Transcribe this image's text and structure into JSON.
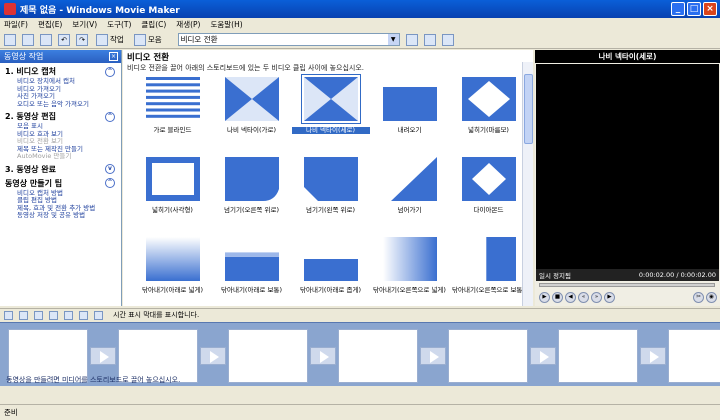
{
  "window": {
    "title": "제목 없음 - Windows Movie Maker"
  },
  "menu": [
    "파일(F)",
    "편집(E)",
    "보기(V)",
    "도구(T)",
    "클립(C)",
    "재생(P)",
    "도움말(H)"
  ],
  "toolbar": {
    "tasks_label": "작업",
    "collections_label": "모음",
    "collection_select": "비디오 전환"
  },
  "taskpane": {
    "header": "동영상 작업",
    "sections": [
      {
        "title": "1. 비디오 캡처",
        "items": [
          {
            "label": "비디오 장치에서 캡처"
          },
          {
            "label": "비디오 가져오기"
          },
          {
            "label": "사진 가져오기"
          },
          {
            "label": "오디오 또는 음악 가져오기"
          }
        ]
      },
      {
        "title": "2. 동영상 편집",
        "items": [
          {
            "label": "모음 표시"
          },
          {
            "label": "비디오 효과 보기"
          },
          {
            "label": "비디오 전환 보기"
          },
          {
            "label": "제목 또는 제작진 만들기"
          },
          {
            "label": "AutoMovie 만들기"
          }
        ]
      },
      {
        "title": "3. 동영상 완료",
        "items": []
      },
      {
        "title": "동영상 만들기 팁",
        "items": [
          {
            "label": "비디오 캡처 방법"
          },
          {
            "label": "클립 편집 방법"
          },
          {
            "label": "제목, 효과 및 전환 추가 방법"
          },
          {
            "label": "동영상 저장 및 공유 방법"
          }
        ]
      }
    ]
  },
  "content": {
    "title": "비디오 전환",
    "description": "비디오 전환을 끌어 아래의 스토리보드에 있는 두 비디오 클립 사이에 놓으십시오.",
    "transitions": [
      {
        "label": "가로 블라인드",
        "icon": "blinds-horizontal"
      },
      {
        "label": "나비 넥타이(가로)",
        "icon": "bowtie-horizontal"
      },
      {
        "label": "나비 넥타이(세로)",
        "icon": "bowtie-vertical"
      },
      {
        "label": "내려오기",
        "icon": "slide-down"
      },
      {
        "label": "넓히기(마름모)",
        "icon": "expand-diamond"
      },
      {
        "label": "넓히기(사각형)",
        "icon": "expand-rectangle"
      },
      {
        "label": "넘기기(오른쪽 위로)",
        "icon": "page-curl-right-up"
      },
      {
        "label": "넘기기(왼쪽 위로)",
        "icon": "page-curl-left-up"
      },
      {
        "label": "넘어가기",
        "icon": "diagonal-wipe"
      },
      {
        "label": "다이아몬드",
        "icon": "diamond"
      },
      {
        "label": "닦아내기(아래로 넓게)",
        "icon": "wipe-down-wide"
      },
      {
        "label": "닦아내기(아래로 보통)",
        "icon": "wipe-down-normal"
      },
      {
        "label": "닦아내기(아래로 좁게)",
        "icon": "wipe-down-narrow"
      },
      {
        "label": "닦아내기(오른쪽으로 넓게)",
        "icon": "wipe-right-wide"
      },
      {
        "label": "닦아내기(오른쪽으로 보통)",
        "icon": "wipe-right-normal"
      }
    ],
    "selected_index": 2
  },
  "preview": {
    "title": "나비 넥타이(세로)",
    "status": "일시 정지됨",
    "time": "0:00:02.00 / 0:00:02.00"
  },
  "storyboard": {
    "toolbar_text": "시간 표시 막대를 표시합니다.",
    "hint": "동영상을 만들려면 미디어를 스토리보드로 끌어 놓으십시오."
  },
  "statusbar": {
    "text": "준비"
  },
  "colors": {
    "titlebar": "#0a5fd8",
    "tile_blue": "#3a6fd0",
    "selection": "#316ac5",
    "storyboard": "#8aa5cf"
  }
}
